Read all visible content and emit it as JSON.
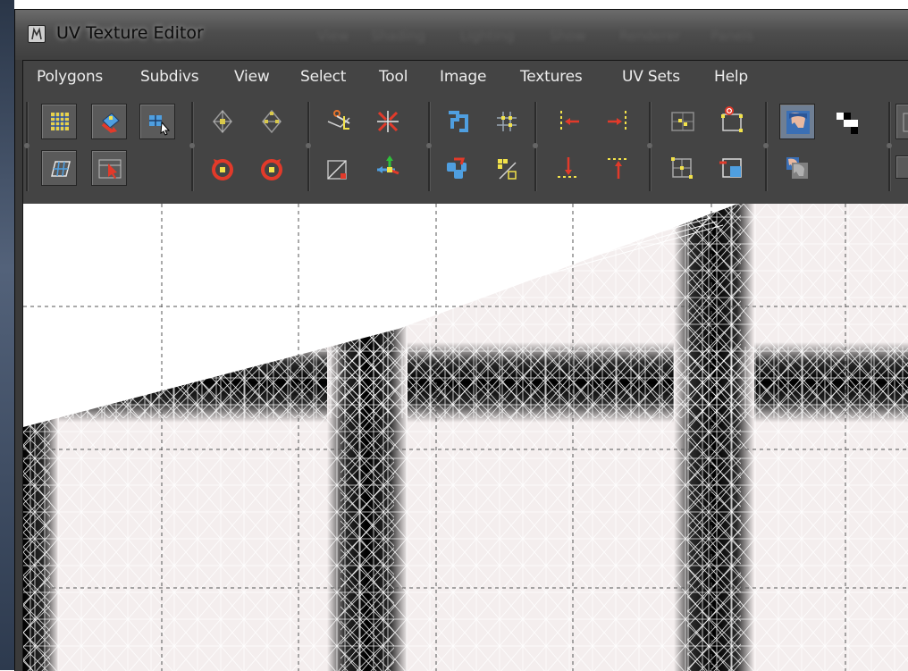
{
  "window": {
    "title": "UV Texture Editor"
  },
  "menus": [
    {
      "label": "Polygons"
    },
    {
      "label": "Subdivs"
    },
    {
      "label": "View"
    },
    {
      "label": "Select"
    },
    {
      "label": "Tool"
    },
    {
      "label": "Image"
    },
    {
      "label": "Textures"
    },
    {
      "label": "UV Sets"
    },
    {
      "label": "Help"
    }
  ],
  "background_menus": [
    "View",
    "Shading",
    "Lighting",
    "Show",
    "Renderer",
    "Panels"
  ],
  "toolbar": {
    "row1_icons": [
      "uv-grid-icon",
      "move-uv-shell-icon",
      "uv-lattice-icon",
      "flip-horizontal-icon",
      "flip-vertical-icon",
      "cut-uv-edges-icon",
      "sew-uv-edges-icon",
      "layout-uvs-icon",
      "grid-uvs-icon",
      "align-min-u-icon",
      "align-max-u-icon",
      "copy-uvs-icon",
      "paste-uvs-icon",
      "display-image-icon",
      "checker-shade-icon"
    ],
    "row2_icons": [
      "uv-smudge-icon",
      "select-shell-icon",
      "rotate-ccw-icon",
      "rotate-ccw-alt-icon",
      "normalize-uvs-icon",
      "unfold-uvs-icon",
      "move-sew-shell-icon",
      "snap-uvs-icon",
      "align-min-v-icon",
      "align-max-v-icon",
      "grid-uv-shell-icon",
      "paste-u-icon",
      "dim-image-icon"
    ]
  },
  "colors": {
    "panel": "#444444",
    "wireframe": "#ffffff",
    "texture_bg": "#f4eeee",
    "texture_bars": "#0a0a0a",
    "selection_yellow": "#f2e24a",
    "accent_red": "#e23a2a",
    "accent_blue": "#4f9fe0"
  }
}
